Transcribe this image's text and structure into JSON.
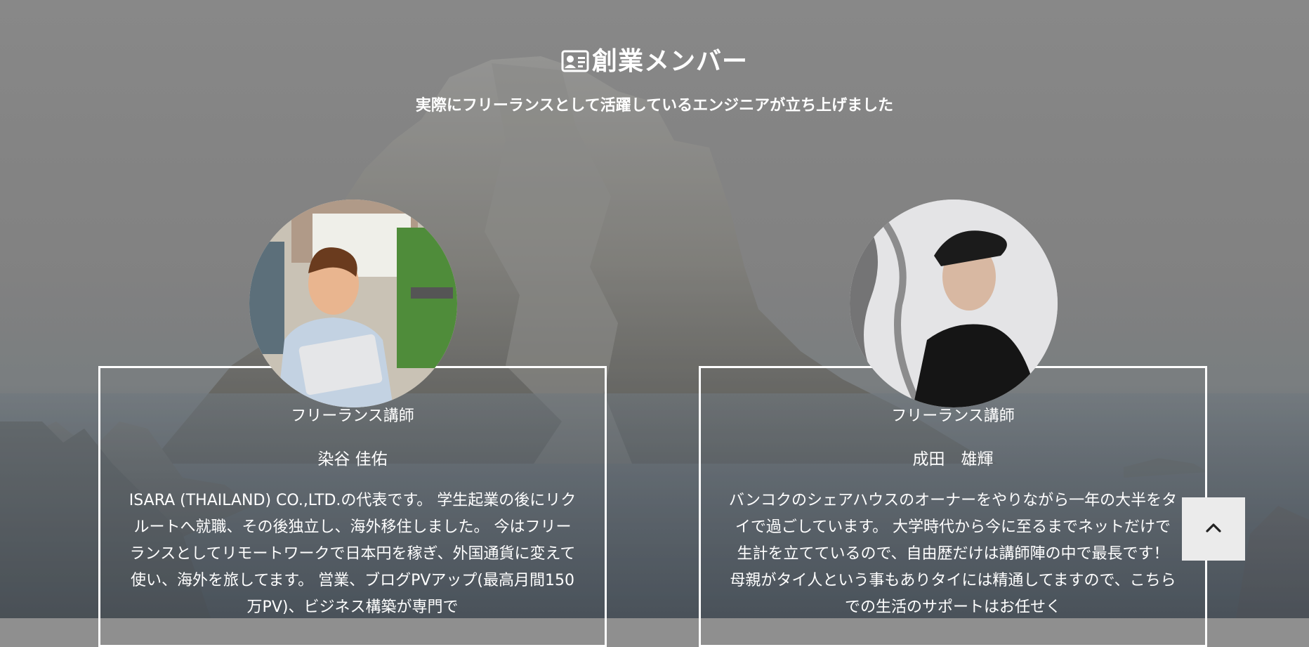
{
  "section": {
    "title": "創業メンバー",
    "subtitle": "実際にフリーランスとして活躍しているエンジニアが立ち上げました"
  },
  "members": [
    {
      "role": "フリーランス講師",
      "name": "染谷 佳佑",
      "bio": "ISARA (THAILAND) CO.,LTD.の代表です。 学生起業の後にリクルートへ就職、その後独立し、海外移住しました。 今はフリーランスとしてリモートワークで日本円を稼ぎ、外国通貨に変えて使い、海外を旅してます。 営業、ブログPVアップ(最高月間150万PV)、ビジネス構築が専門で"
    },
    {
      "role": "フリーランス講師",
      "name": "成田　雄輝",
      "bio": "バンコクのシェアハウスのオーナーをやりながら一年の大半をタイで過ごしています。 大学時代から今に至るまでネットだけで生計を立てているので、自由歴だけは講師陣の中で最長です！ 母親がタイ人という事もありタイには精通してますので、こちらでの生活のサポートはお任せく"
    }
  ],
  "icons": {
    "title_icon": "id-card-icon",
    "scroll_top_icon": "chevron-up-icon"
  },
  "colors": {
    "text": "#ffffff",
    "card_border": "#ffffff",
    "scroll_button_bg": "#ebebeb"
  }
}
